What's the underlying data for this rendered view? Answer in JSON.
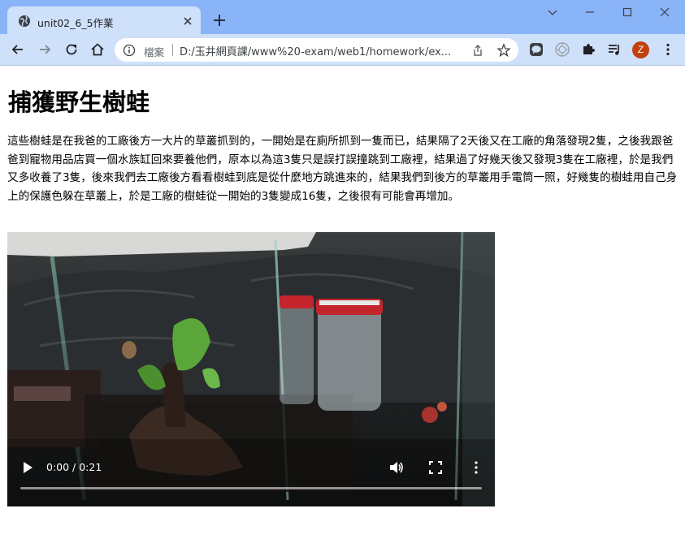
{
  "browser": {
    "tab_title": "unit02_6_5作業",
    "omnibox": {
      "security_label": "檔案",
      "url": "D:/玉井網頁課/www%20-exam/web1/homework/ex..."
    },
    "profile_initial": "Z"
  },
  "page": {
    "title": "捕獲野生樹蛙",
    "paragraph": "這些樹蛙是在我爸的工廠後方一大片的草叢抓到的，一開始是在廁所抓到一隻而已，結果隔了2天後又在工廠的角落發現2隻，之後我跟爸爸到寵物用品店買一個水族缸回來要養他們，原本以為這3隻只是誤打誤撞跳到工廠裡，結果過了好幾天後又發現3隻在工廠裡，於是我們又多收養了3隻，後來我們去工廠後方看看樹蛙到底是從什麼地方跳進來的，結果我們到後方的草叢用手電筒一照，好幾隻的樹蛙用自己身上的保護色躲在草叢上，於是工廠的樹蛙從一開始的3隻變成16隻，之後很有可能會再增加。"
  },
  "video": {
    "time_display": "0:00 / 0:21",
    "progress": 0
  },
  "colors": {
    "titlebar": "#8ab4f8",
    "toolbar": "#cfe0fb",
    "avatar": "#c2410c"
  }
}
